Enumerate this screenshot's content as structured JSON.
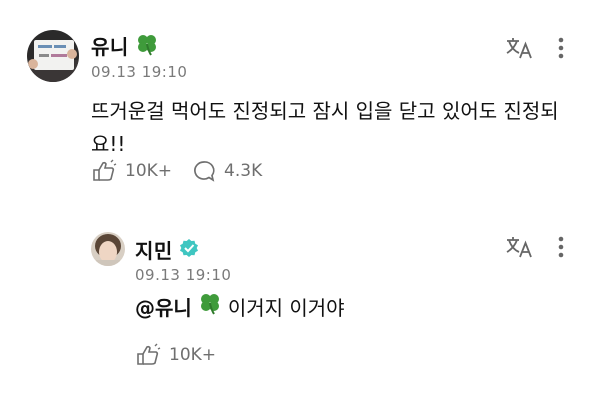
{
  "comment": {
    "author": "유니",
    "timestamp": "09.13 19:10",
    "text_line1": "뜨거운걸 먹어도 진정되고 잠시 입을 닫고 있어도 진정되",
    "text_line2": "요!!",
    "likes": "10K+",
    "replies": "4.3K"
  },
  "reply": {
    "author": "지민",
    "verified": true,
    "timestamp": "09.13 19:10",
    "mention": "@유니",
    "text": "이거지 이거야",
    "likes": "10K+"
  },
  "icons": {
    "clover": "four-leaf-clover-icon",
    "translate": "translate-icon",
    "more": "more-vertical-icon",
    "like": "like-hand-icon",
    "reply": "speech-bubble-icon",
    "verified": "verified-badge-icon"
  },
  "colors": {
    "clover_green": "#3f9b3b",
    "verified_teal": "#3fc6c1",
    "muted_gray": "#7a7a7a"
  }
}
